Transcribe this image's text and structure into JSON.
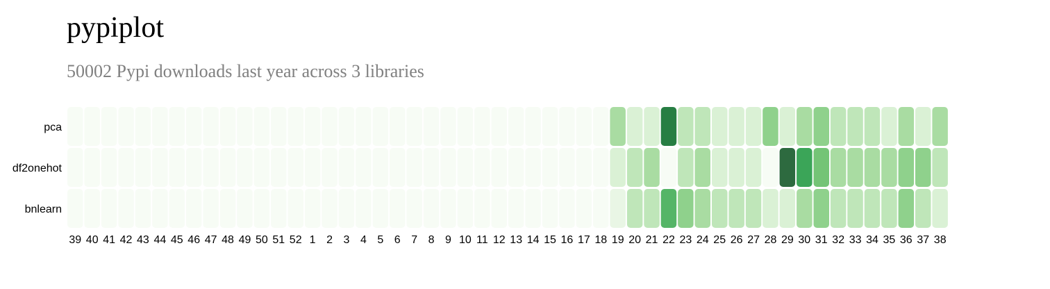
{
  "title": "pypiplot",
  "subtitle": "50002 Pypi downloads last year across 3 libraries",
  "chart_data": {
    "type": "heatmap",
    "title": "",
    "xlabel": "",
    "ylabel": "",
    "x": [
      "39",
      "40",
      "41",
      "42",
      "43",
      "44",
      "45",
      "46",
      "47",
      "48",
      "49",
      "50",
      "51",
      "52",
      "1",
      "2",
      "3",
      "4",
      "5",
      "6",
      "7",
      "8",
      "9",
      "10",
      "11",
      "12",
      "13",
      "14",
      "15",
      "16",
      "17",
      "18",
      "19",
      "20",
      "21",
      "22",
      "23",
      "24",
      "25",
      "26",
      "27",
      "28",
      "29",
      "30",
      "31",
      "32",
      "33",
      "34",
      "35",
      "36",
      "37",
      "38"
    ],
    "y": [
      "pca",
      "df2onehot",
      "bnlearn"
    ],
    "values": [
      [
        0,
        0,
        0,
        0,
        0,
        0,
        0,
        0,
        0,
        0,
        0,
        0,
        0,
        0,
        0,
        0,
        0,
        0,
        0,
        0,
        0,
        0,
        0,
        0,
        0,
        0,
        0,
        0,
        0,
        0,
        0,
        0,
        3,
        1,
        1,
        9,
        2,
        2,
        1,
        1,
        1,
        4,
        1,
        3,
        4,
        2,
        2,
        2,
        1,
        3,
        1,
        3
      ],
      [
        0,
        0,
        0,
        0,
        0,
        0,
        0,
        0,
        0,
        0,
        0,
        0,
        0,
        0,
        0,
        0,
        0,
        0,
        0,
        0,
        0,
        0,
        0,
        0,
        0,
        0,
        0,
        0,
        0,
        0,
        0,
        0,
        1,
        2,
        3,
        0,
        2,
        3,
        1,
        1,
        1,
        0,
        10,
        7,
        5,
        3,
        3,
        3,
        3,
        4,
        4,
        2
      ],
      [
        0,
        0,
        0,
        0,
        0,
        0,
        0,
        0,
        0,
        0,
        0,
        0,
        0,
        0,
        0,
        0,
        0,
        0,
        0,
        0,
        0,
        0,
        0,
        0,
        0,
        0,
        0,
        0,
        0,
        0,
        0,
        0,
        0.5,
        2,
        2,
        6,
        4,
        3,
        2,
        2,
        2,
        1,
        1,
        3,
        4,
        2,
        2,
        2,
        2,
        4,
        2,
        1
      ]
    ],
    "value_range": [
      0,
      10
    ],
    "color_scale": [
      "#f7fcf5",
      "#c7e9c0",
      "#a1d99b",
      "#74c476",
      "#41ab5d",
      "#238b45",
      "#2d6a3f"
    ],
    "grid": false,
    "legend": "none"
  }
}
